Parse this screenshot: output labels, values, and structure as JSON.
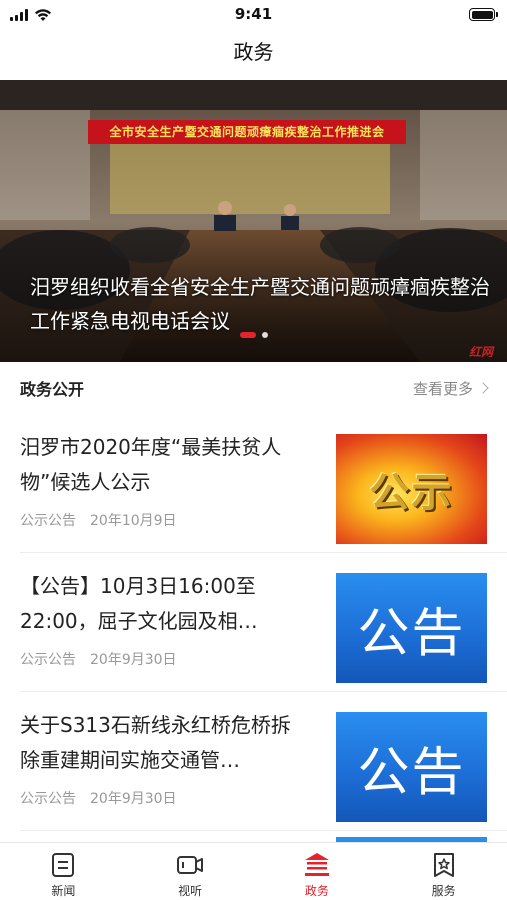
{
  "status_bar": {
    "time": "9:41"
  },
  "nav": {
    "title": "政务"
  },
  "banner": {
    "sign_text": "全市安全生产暨交通问题顽瘴痼疾整治工作推进会",
    "caption": "汨罗组织收看全省安全生产暨交通问题顽瘴痼疾整治工作紧急电视电话会议",
    "watermark": "红网",
    "slide_count": 2,
    "active_slide": 1
  },
  "section": {
    "title": "政务公开",
    "more_label": "查看更多"
  },
  "news": [
    {
      "title": "汨罗市2020年度“最美扶贫人物”候选人公示",
      "category": "公示公告",
      "date": "20年10月9日",
      "thumb_text": "公示",
      "thumb_icon": "gongshi-image"
    },
    {
      "title": "【公告】10月3日16:00至22:00，屈子文化园及相…",
      "category": "公示公告",
      "date": "20年9月30日",
      "thumb_text": "公告",
      "thumb_icon": "gonggao-image"
    },
    {
      "title": "关于S313石新线永红桥危桥拆除重建期间实施交通管…",
      "category": "公示公告",
      "date": "20年9月30日",
      "thumb_text": "公告",
      "thumb_icon": "gonggao-image"
    }
  ],
  "tabs": [
    {
      "label": "新闻",
      "icon": "news-icon",
      "active": false
    },
    {
      "label": "视听",
      "icon": "video-icon",
      "active": false
    },
    {
      "label": "政务",
      "icon": "government-icon",
      "active": true
    },
    {
      "label": "服务",
      "icon": "service-icon",
      "active": false
    }
  ],
  "colors": {
    "accent": "#e5232c",
    "text": "#222222",
    "muted": "#999999"
  }
}
